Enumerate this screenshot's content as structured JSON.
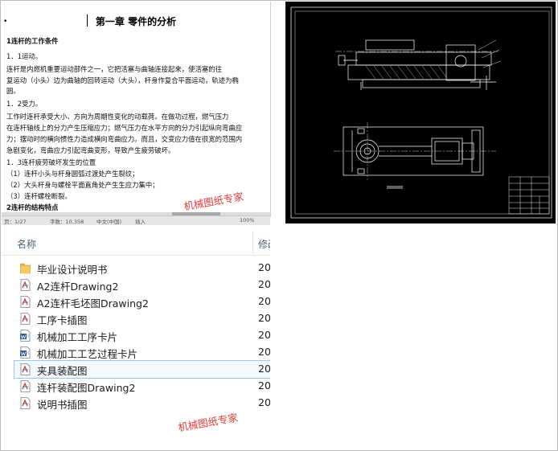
{
  "document": {
    "title": "第一章  零件的分析",
    "lines": [
      "1连杆的工作条件",
      "1．1运动。",
      "    连杆是内燃机重要运动部件之一，它把活塞与曲轴连接起来，使活塞的往",
      "复运动（小头）边为曲轴的回转运动（大头），杆身作复合平面运动，轨迹为椭",
      "圆。",
      "1．2受力。",
      "    工作时连杆承受大小、方向为周期性变化的动载荷。在做功过程，燃气压力",
      "在连杆轴线上的分力产生压缩应力；燃气压力在水平方向的分力引起纵向弯曲应",
      "力；摆动时的横向惯性力造成横向弯曲应力。而且，交变应力值在很宽的范围内",
      "急剧变化，弯曲应力引起弯曲变形，导致产生疲劳破坏。",
      "1．3连杆疲劳破坏发生的位置",
      "（1）连杆小头与杆身圆弧过渡处产生裂纹；",
      "（2）大头杆身与螺栓平面直角处产生生应力集中；",
      "（3）连杆螺栓断裂。",
      "2连杆的结构特点"
    ],
    "status": {
      "page": "页：1/27",
      "words": "字数：10,358",
      "lang": "中文(中国)",
      "mode": "插入",
      "zoom": "100%"
    }
  },
  "watermark_text": "机械图纸专家",
  "explorer": {
    "columns": {
      "name": "名称",
      "modified": "修改"
    },
    "files": [
      {
        "name": "毕业设计说明书",
        "type": "folder",
        "year": "20"
      },
      {
        "name": "A2连杆Drawing2",
        "type": "drawing",
        "year": "20"
      },
      {
        "name": "A2连杆毛坯图Drawing2",
        "type": "drawing",
        "year": "20"
      },
      {
        "name": "工序卡插图",
        "type": "drawing",
        "year": "20"
      },
      {
        "name": "机械加工工序卡片",
        "type": "word",
        "year": "20"
      },
      {
        "name": "机械加工工艺过程卡片",
        "type": "word",
        "year": "20"
      },
      {
        "name": "夹具装配图",
        "type": "drawing",
        "year": "20",
        "selected": true
      },
      {
        "name": "连杆装配图Drawing2",
        "type": "drawing",
        "year": "20"
      },
      {
        "name": "说明书插图",
        "type": "drawing",
        "year": "20"
      }
    ]
  },
  "colors": {
    "cad_background": "#000000",
    "cad_lines": "#ffffff",
    "watermark": "#e53935",
    "selection_border": "#99c8f0",
    "header_text": "#4c607a"
  }
}
